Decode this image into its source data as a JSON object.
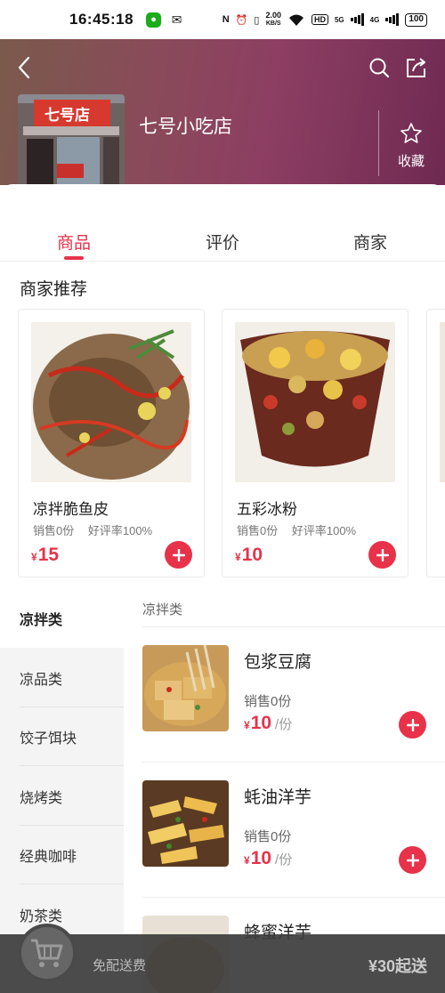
{
  "status_bar": {
    "time": "16:45:18",
    "net_speed_value": "2.00",
    "net_speed_unit": "KB/S",
    "hd_label": "HD",
    "sig1": "5G",
    "sig2": "4G",
    "battery": "100"
  },
  "header": {
    "shop_name": "七号小吃店",
    "favorite_label": "收藏",
    "shop_sign": "七号店"
  },
  "tabs": [
    {
      "label": "商品",
      "active": true
    },
    {
      "label": "评价",
      "active": false
    },
    {
      "label": "商家",
      "active": false
    }
  ],
  "recommend": {
    "title": "商家推荐",
    "items": [
      {
        "name": "凉拌脆鱼皮",
        "sales": "销售0份",
        "rating": "好评率100%",
        "currency": "¥",
        "price": "15"
      },
      {
        "name": "五彩冰粉",
        "sales": "销售0份",
        "rating": "好评率100%",
        "currency": "¥",
        "price": "10"
      }
    ]
  },
  "sidebar": {
    "categories": [
      "凉拌类",
      "凉品类",
      "饺子饵块",
      "烧烤类",
      "经典咖啡",
      "奶茶类"
    ],
    "active_index": 0
  },
  "menu": {
    "category_title": "凉拌类",
    "items": [
      {
        "name": "包浆豆腐",
        "sales": "销售0份",
        "currency": "¥",
        "price": "10",
        "unit": "/份"
      },
      {
        "name": "蚝油洋芋",
        "sales": "销售0份",
        "currency": "¥",
        "price": "10",
        "unit": "/份"
      },
      {
        "name": "蜂蜜洋芋",
        "sales": "",
        "currency": "",
        "price": "",
        "unit": ""
      }
    ]
  },
  "cart": {
    "delivery_text": "免配送费",
    "min_order_text": "¥30起送"
  },
  "colors": {
    "accent": "#e8324a",
    "header_start": "#7a5a4c",
    "header_end": "#6f2a52"
  }
}
